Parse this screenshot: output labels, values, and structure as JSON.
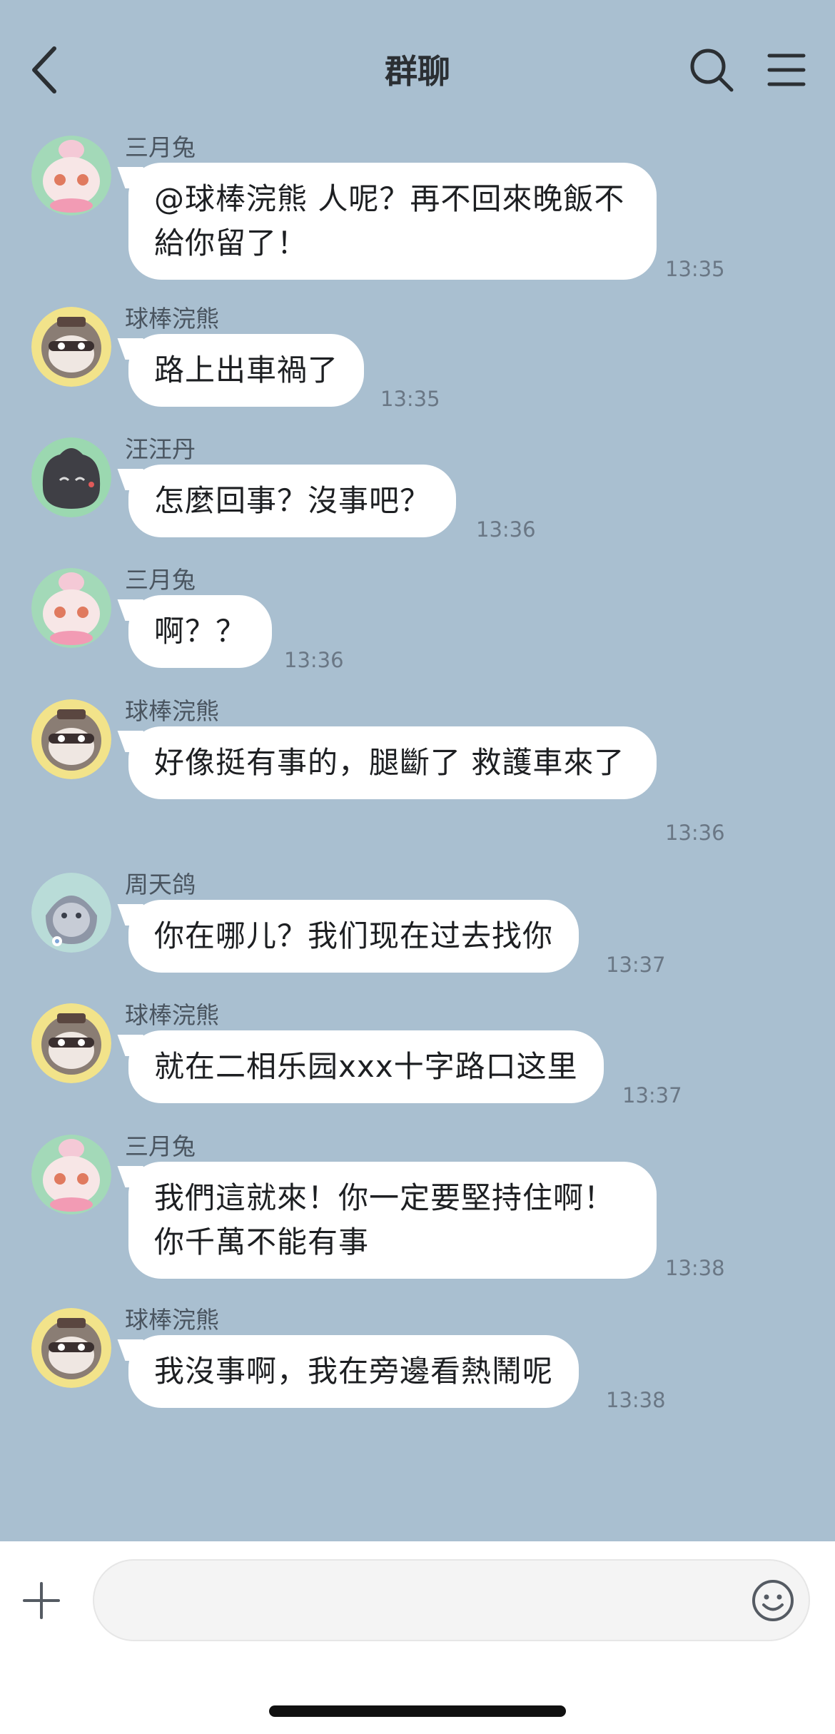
{
  "header": {
    "title": "群聊",
    "back_icon": "chevron-left-icon",
    "search_icon": "search-icon",
    "menu_icon": "hamburger-menu-icon"
  },
  "messages": [
    {
      "sender": "三月兔",
      "avatar": "rabbit",
      "text": "@球棒浣熊   人呢？再不回來晚飯不給你留了！",
      "time": "13:35"
    },
    {
      "sender": "球棒浣熊",
      "avatar": "raccoon",
      "text": "路上出車禍了",
      "time": "13:35"
    },
    {
      "sender": "汪汪丹",
      "avatar": "dark",
      "text": "怎麼回事？沒事吧？",
      "time": "13:36"
    },
    {
      "sender": "三月兔",
      "avatar": "rabbit",
      "text": "啊？？",
      "time": "13:36"
    },
    {
      "sender": "球棒浣熊",
      "avatar": "raccoon",
      "text": "好像挺有事的，腿斷了   救護車來了",
      "time": "13:36"
    },
    {
      "sender": "周天鸽",
      "avatar": "pigeon",
      "text": "你在哪儿？我们现在过去找你",
      "time": "13:37"
    },
    {
      "sender": "球棒浣熊",
      "avatar": "raccoon",
      "text": "就在二相乐园xxx十字路口这里",
      "time": "13:37"
    },
    {
      "sender": "三月兔",
      "avatar": "rabbit",
      "text": "我們這就來！你一定要堅持住啊！你千萬不能有事",
      "time": "13:38"
    },
    {
      "sender": "球棒浣熊",
      "avatar": "raccoon",
      "text": "我沒事啊，我在旁邊看熱鬧呢",
      "time": "13:38"
    }
  ],
  "input": {
    "value": "",
    "placeholder": "",
    "plus_icon": "plus-icon",
    "emoji_icon": "smiley-emoji-icon"
  }
}
